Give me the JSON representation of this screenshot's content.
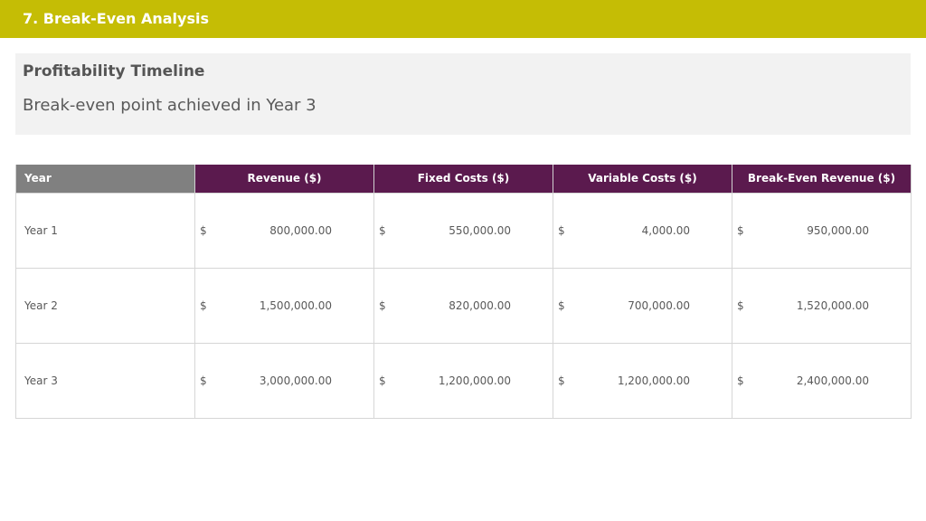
{
  "header": {
    "title": "7. Break-Even Analysis"
  },
  "summary": {
    "heading": "Profitability Timeline",
    "subtitle": "Break-even point achieved in Year 3"
  },
  "table": {
    "columns": [
      "Year",
      "Revenue ($)",
      "Fixed Costs ($)",
      "Variable Costs ($)",
      "Break-Even Revenue ($)"
    ],
    "currency_symbol": "$",
    "rows": [
      {
        "year": "Year 1",
        "revenue": "800,000.00",
        "fixed_costs": "550,000.00",
        "variable_costs": "4,000.00",
        "break_even_revenue": "950,000.00"
      },
      {
        "year": "Year 2",
        "revenue": "1,500,000.00",
        "fixed_costs": "820,000.00",
        "variable_costs": "700,000.00",
        "break_even_revenue": "1,520,000.00"
      },
      {
        "year": "Year 3",
        "revenue": "3,000,000.00",
        "fixed_costs": "1,200,000.00",
        "variable_costs": "1,200,000.00",
        "break_even_revenue": "2,400,000.00"
      }
    ]
  },
  "colors": {
    "title_bar": "#c5bd05",
    "header_purple": "#5b1a4e",
    "header_gray": "#808080",
    "summary_bg": "#f2f2f2"
  }
}
